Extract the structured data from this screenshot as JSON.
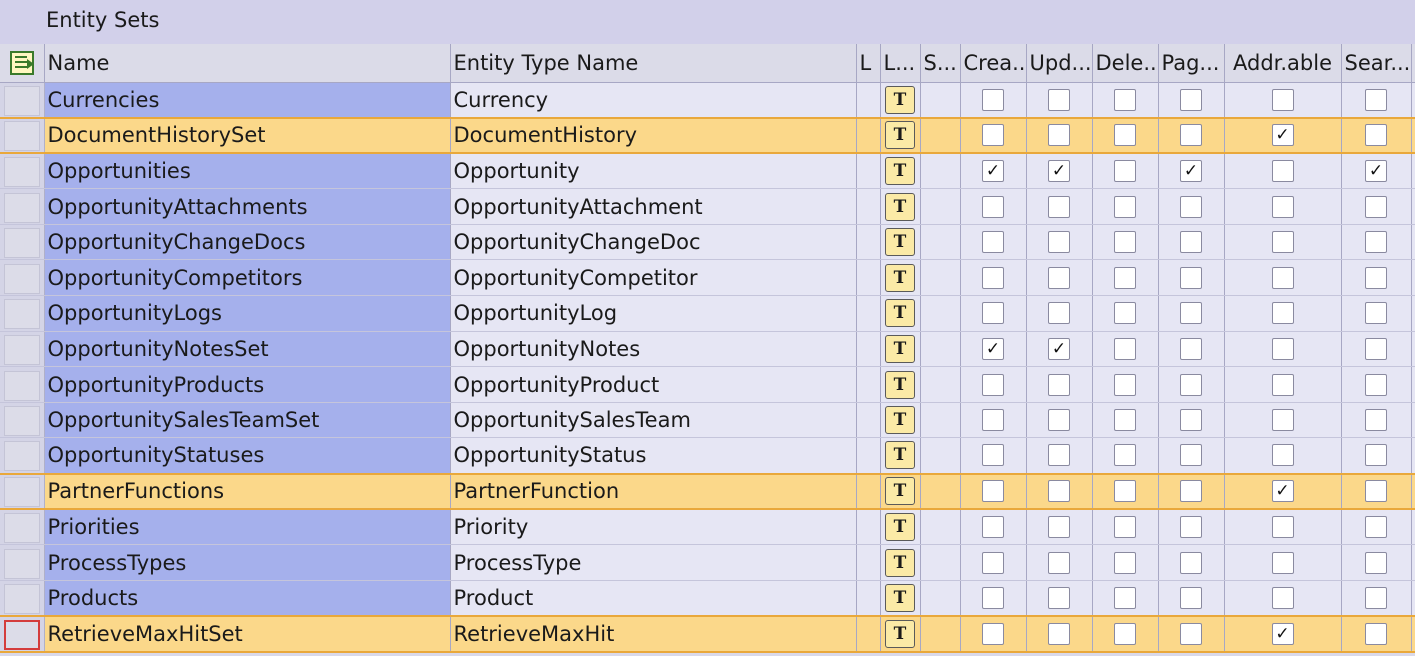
{
  "panel_title": "Entity Sets",
  "columns": {
    "name": "Name",
    "entity_type": "Entity Type Name",
    "l": "L",
    "l2": "L...",
    "s": "S...",
    "create": "Crea...",
    "update": "Upd...",
    "delete": "Dele...",
    "page": "Pag...",
    "addressable": "Addr.able",
    "search": "Sear...",
    "more": "S"
  },
  "checkmark": "✓",
  "label_icon_glyph": "T",
  "rows": [
    {
      "name": "Currencies",
      "entity_type": "Currency",
      "create": false,
      "update": false,
      "delete": false,
      "page": false,
      "addressable": false,
      "search": false
    },
    {
      "name": "DocumentHistorySet",
      "entity_type": "DocumentHistory",
      "create": false,
      "update": false,
      "delete": false,
      "page": false,
      "addressable": true,
      "search": false
    },
    {
      "name": "Opportunities",
      "entity_type": "Opportunity",
      "create": true,
      "update": true,
      "delete": false,
      "page": true,
      "addressable": false,
      "search": true
    },
    {
      "name": "OpportunityAttachments",
      "entity_type": "OpportunityAttachment",
      "create": false,
      "update": false,
      "delete": false,
      "page": false,
      "addressable": false,
      "search": false
    },
    {
      "name": "OpportunityChangeDocs",
      "entity_type": "OpportunityChangeDoc",
      "create": false,
      "update": false,
      "delete": false,
      "page": false,
      "addressable": false,
      "search": false
    },
    {
      "name": "OpportunityCompetitors",
      "entity_type": "OpportunityCompetitor",
      "create": false,
      "update": false,
      "delete": false,
      "page": false,
      "addressable": false,
      "search": false
    },
    {
      "name": "OpportunityLogs",
      "entity_type": "OpportunityLog",
      "create": false,
      "update": false,
      "delete": false,
      "page": false,
      "addressable": false,
      "search": false
    },
    {
      "name": "OpportunityNotesSet",
      "entity_type": "OpportunityNotes",
      "create": true,
      "update": true,
      "delete": false,
      "page": false,
      "addressable": false,
      "search": false
    },
    {
      "name": "OpportunityProducts",
      "entity_type": "OpportunityProduct",
      "create": false,
      "update": false,
      "delete": false,
      "page": false,
      "addressable": false,
      "search": false
    },
    {
      "name": "OpportunitySalesTeamSet",
      "entity_type": "OpportunitySalesTeam",
      "create": false,
      "update": false,
      "delete": false,
      "page": false,
      "addressable": false,
      "search": false
    },
    {
      "name": "OpportunityStatuses",
      "entity_type": "OpportunityStatus",
      "create": false,
      "update": false,
      "delete": false,
      "page": false,
      "addressable": false,
      "search": false
    },
    {
      "name": "PartnerFunctions",
      "entity_type": "PartnerFunction",
      "create": false,
      "update": false,
      "delete": false,
      "page": false,
      "addressable": true,
      "search": false
    },
    {
      "name": "Priorities",
      "entity_type": "Priority",
      "create": false,
      "update": false,
      "delete": false,
      "page": false,
      "addressable": false,
      "search": false
    },
    {
      "name": "ProcessTypes",
      "entity_type": "ProcessType",
      "create": false,
      "update": false,
      "delete": false,
      "page": false,
      "addressable": false,
      "search": false
    },
    {
      "name": "Products",
      "entity_type": "Product",
      "create": false,
      "update": false,
      "delete": false,
      "page": false,
      "addressable": false,
      "search": false
    },
    {
      "name": "RetrieveMaxHitSet",
      "entity_type": "RetrieveMaxHit",
      "create": false,
      "update": false,
      "delete": false,
      "page": false,
      "addressable": true,
      "search": false
    }
  ],
  "highlighted_rows": [
    "DocumentHistorySet",
    "PartnerFunctions",
    "RetrieveMaxHitSet"
  ],
  "focused_row": "RetrieveMaxHitSet",
  "colors": {
    "name_column": "#a5b0ec",
    "highlight_row": "#fbd88a",
    "highlight_border": "#e9a83b",
    "focus_border": "#d43c3c"
  }
}
